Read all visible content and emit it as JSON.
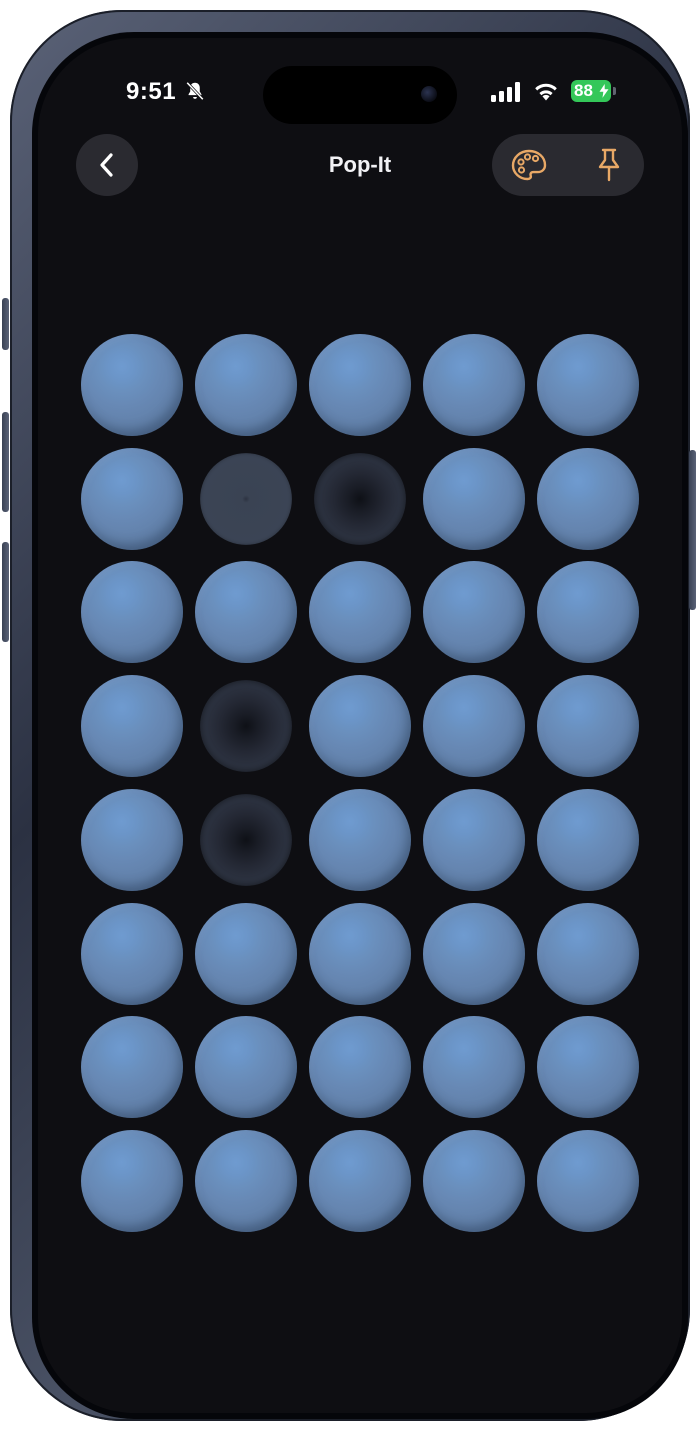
{
  "status_bar": {
    "time": "9:51",
    "battery_level": "88",
    "icons": [
      "bell-slash-icon",
      "cellular-signal-icon",
      "wifi-icon",
      "battery-charging-icon"
    ],
    "battery_color": "#34c759"
  },
  "nav": {
    "title": "Pop-It",
    "back_icon": "chevron-left-icon",
    "actions": [
      "palette-icon",
      "pin-icon"
    ],
    "accent_color": "#e8a866"
  },
  "grid": {
    "rows": 8,
    "columns": 5,
    "raised_color": "#6b8fbf",
    "popped_color": "#2c3240",
    "cells": [
      [
        "raised",
        "raised",
        "raised",
        "raised",
        "raised"
      ],
      [
        "raised",
        "popped-light",
        "popped",
        "raised",
        "raised"
      ],
      [
        "raised",
        "raised",
        "raised",
        "raised",
        "raised"
      ],
      [
        "raised",
        "popped",
        "raised",
        "raised",
        "raised"
      ],
      [
        "raised",
        "popped",
        "raised",
        "raised",
        "raised"
      ],
      [
        "raised",
        "raised",
        "raised",
        "raised",
        "raised"
      ],
      [
        "raised",
        "raised",
        "raised",
        "raised",
        "raised"
      ],
      [
        "raised",
        "raised",
        "raised",
        "raised",
        "raised"
      ]
    ]
  }
}
